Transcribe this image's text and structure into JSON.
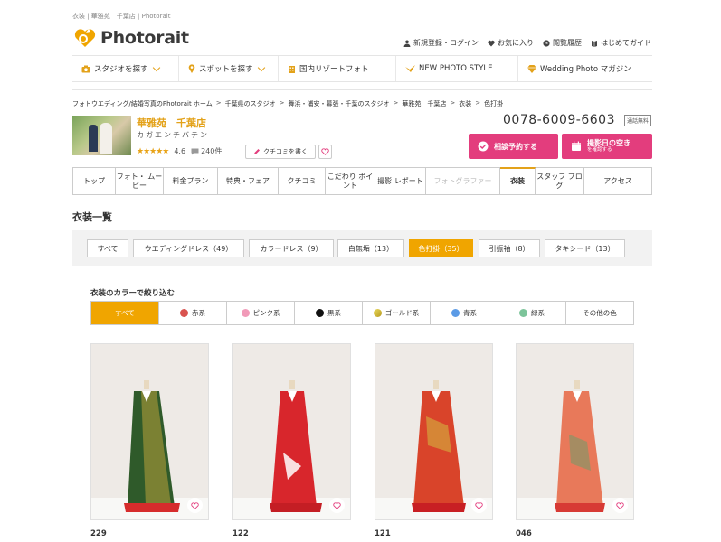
{
  "topline": "衣装 | 華雅苑　千葉店 | Photorait",
  "brand": {
    "name": "Photorait"
  },
  "utility": [
    {
      "label": "新規登録・ログイン",
      "icon": "user-icon"
    },
    {
      "label": "お気に入り",
      "icon": "heart-icon"
    },
    {
      "label": "閲覧履歴",
      "icon": "clock-icon"
    },
    {
      "label": "はじめてガイド",
      "icon": "book-icon"
    }
  ],
  "gnav": [
    {
      "label": "スタジオを探す",
      "icon": "camera-icon"
    },
    {
      "label": "スポットを探す",
      "icon": "pin-icon"
    },
    {
      "label": "国内リゾートフォト",
      "icon": "building-icon"
    },
    {
      "label": "NEW PHOTO STYLE",
      "icon": "bird-icon"
    },
    {
      "label": "Wedding Photo マガジン",
      "icon": "diamond-icon"
    }
  ],
  "breadcrumb": [
    "フォトウエディング/結婚写真のPhotorait ホーム",
    "千葉県のスタジオ",
    "舞浜・浦安・幕張・千葉のスタジオ",
    "華雅苑　千葉店",
    "衣装",
    "色打掛"
  ],
  "studio": {
    "name": "華雅苑　千葉店",
    "kana": "カガエンチバテン",
    "stars": "★★★★★",
    "rating": "4.6",
    "reviews": "240件",
    "review_button": "クチコミを書く",
    "phone": "0078-6009-6603",
    "phone_badge": "通話無料",
    "cta_consult": "相談予約する",
    "cta_check": "撮影日の空き",
    "cta_check_sub": "を確認する"
  },
  "tabs": [
    {
      "label": "トップ"
    },
    {
      "label": "フォト・ ムービー"
    },
    {
      "label": "料金プラン"
    },
    {
      "label": "特典・フェア"
    },
    {
      "label": "クチコミ"
    },
    {
      "label": "こだわり ポイント"
    },
    {
      "label": "撮影 レポート"
    },
    {
      "label": "フォトグラファー"
    },
    {
      "label": "衣装"
    },
    {
      "label": "スタッフ ブログ"
    },
    {
      "label": "アクセス"
    }
  ],
  "section_title": "衣装一覧",
  "categories": [
    "すべて",
    "ウエディングドレス（49）",
    "カラードレス（9）",
    "白無垢（13）",
    "色打掛（35）",
    "引振袖（8）",
    "タキシード（13）"
  ],
  "filter_title": "衣装のカラーで絞り込む",
  "colors": [
    {
      "label": "すべて",
      "color": ""
    },
    {
      "label": "赤系",
      "color": "#d9534f"
    },
    {
      "label": "ピンク系",
      "color": "#f19ab8"
    },
    {
      "label": "黒系",
      "color": "#111111"
    },
    {
      "label": "ゴールド系",
      "color": "#d8c24a"
    },
    {
      "label": "青系",
      "color": "#5b9be6"
    },
    {
      "label": "緑系",
      "color": "#7cc49a"
    },
    {
      "label": "その他の色",
      "color": ""
    }
  ],
  "items": [
    {
      "number": "229",
      "main": "#2f5a2a",
      "accent": "#b9a23a",
      "hem": "#d62c2c"
    },
    {
      "number": "122",
      "main": "#d8262c",
      "accent": "#ffffff",
      "hem": "#c41e24"
    },
    {
      "number": "121",
      "main": "#d9442a",
      "accent": "#d4a23c",
      "hem": "#c81f23"
    },
    {
      "number": "046",
      "main": "#e8795a",
      "accent": "#6d9c6a",
      "hem": "#d73a34"
    }
  ]
}
